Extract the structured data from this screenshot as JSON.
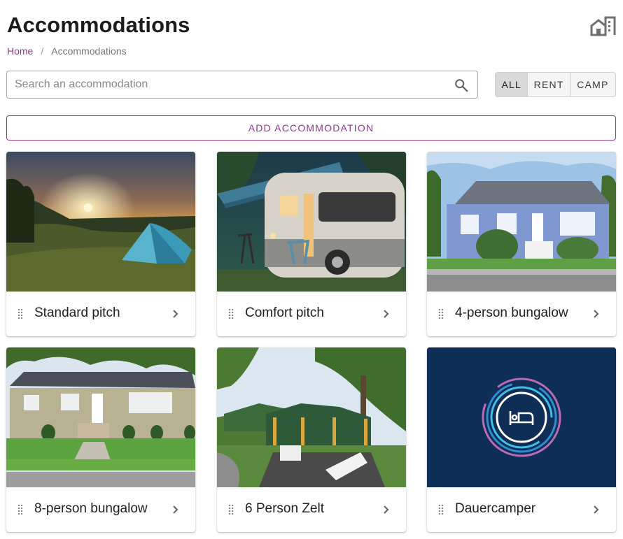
{
  "header": {
    "title": "Accommodations",
    "icon": "house-building-icon"
  },
  "breadcrumb": {
    "home": "Home",
    "separator": "/",
    "current": "Accommodations"
  },
  "search": {
    "placeholder": "Search an accommodation",
    "value": ""
  },
  "filter": {
    "options": [
      "ALL",
      "RENT",
      "CAMP"
    ],
    "selected": "ALL"
  },
  "add_button": {
    "label": "ADD ACCOMMODATION"
  },
  "cards": [
    {
      "title": "Standard pitch",
      "image": "sunset-tent-photo"
    },
    {
      "title": "Comfort pitch",
      "image": "caravan-awning-photo"
    },
    {
      "title": "4-person bungalow",
      "image": "blue-house-photo"
    },
    {
      "title": "8-person bungalow",
      "image": "beige-house-photo"
    },
    {
      "title": "6 Person Zelt",
      "image": "green-tents-photo"
    },
    {
      "title": "Dauercamper",
      "image": "bed-logo-placeholder"
    }
  ],
  "colors": {
    "accent": "#8e3a8c",
    "placeholder_tile": "#0e2d57"
  }
}
